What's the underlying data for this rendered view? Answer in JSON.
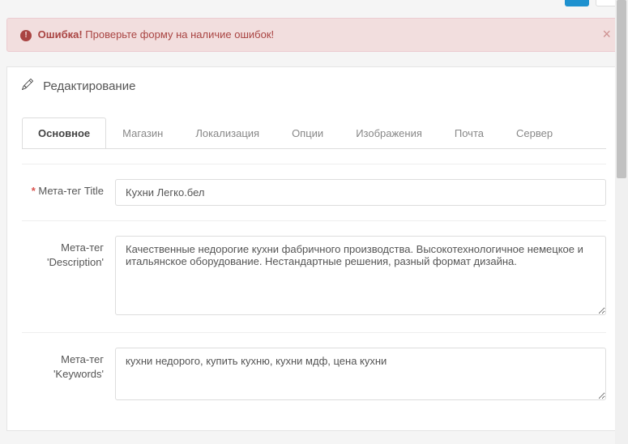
{
  "alert": {
    "bold": "Ошибка!",
    "text": " Проверьте форму на наличие ошибок!",
    "close": "×"
  },
  "panel": {
    "title": "Редактирование"
  },
  "tabs": [
    {
      "label": "Основное",
      "active": true
    },
    {
      "label": "Магазин",
      "active": false
    },
    {
      "label": "Локализация",
      "active": false
    },
    {
      "label": "Опции",
      "active": false
    },
    {
      "label": "Изображения",
      "active": false
    },
    {
      "label": "Почта",
      "active": false
    },
    {
      "label": "Сервер",
      "active": false
    }
  ],
  "form": {
    "meta_title": {
      "label": "Мета-тег Title",
      "required": "*",
      "value": "Кухни Легко.бел"
    },
    "meta_description": {
      "label": "Мета-тег 'Description'",
      "value": "Качественные недорогие кухни фабричного производства. Высокотехнологичное немецкое и итальянское оборудование. Нестандартные решения, разный формат дизайна."
    },
    "meta_keywords": {
      "label": "Мета-тег 'Keywords'",
      "value": "кухни недорого, купить кухню, кухни мдф, цена кухни"
    }
  }
}
